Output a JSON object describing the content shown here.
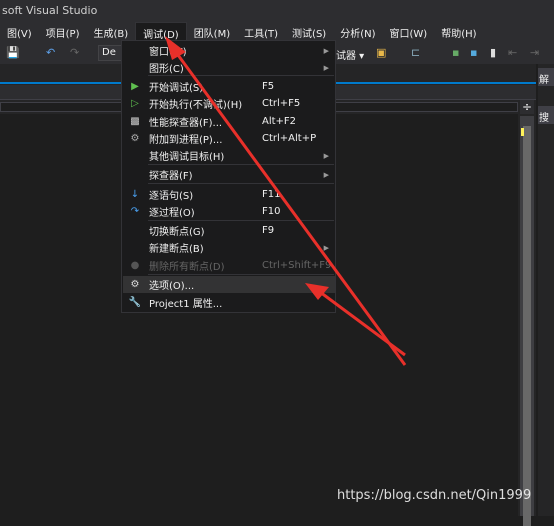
{
  "window": {
    "title": "soft Visual Studio"
  },
  "menubar": [
    "图(V)",
    "项目(P)",
    "生成(B)",
    "调试(D)",
    "团队(M)",
    "工具(T)",
    "测试(S)",
    "分析(N)",
    "窗口(W)",
    "帮助(H)"
  ],
  "toolbar": {
    "config": "De",
    "debugger_tail": "试器 ▾"
  },
  "right_panel": {
    "header": "解",
    "search": "搜"
  },
  "debug_menu": [
    {
      "label": "窗口(W)",
      "shortcut": "",
      "submenu": true,
      "icon": ""
    },
    {
      "label": "图形(C)",
      "shortcut": "",
      "submenu": true,
      "icon": ""
    },
    {
      "label": "开始调试(S)",
      "shortcut": "F5",
      "icon": "play-icon"
    },
    {
      "label": "开始执行(不调试)(H)",
      "shortcut": "Ctrl+F5",
      "icon": "play-outline-icon"
    },
    {
      "label": "性能探查器(F)...",
      "shortcut": "Alt+F2",
      "icon": "performance-icon"
    },
    {
      "label": "附加到进程(P)...",
      "shortcut": "Ctrl+Alt+P",
      "icon": "attach-icon"
    },
    {
      "label": "其他调试目标(H)",
      "shortcut": "",
      "submenu": true,
      "icon": ""
    },
    {
      "label": "探查器(F)",
      "shortcut": "",
      "submenu": true,
      "icon": ""
    },
    {
      "label": "逐语句(S)",
      "shortcut": "F11",
      "icon": "step-into-icon"
    },
    {
      "label": "逐过程(O)",
      "shortcut": "F10",
      "icon": "step-over-icon"
    },
    {
      "label": "切换断点(G)",
      "shortcut": "F9",
      "icon": ""
    },
    {
      "label": "新建断点(B)",
      "shortcut": "",
      "submenu": true,
      "icon": ""
    },
    {
      "label": "删除所有断点(D)",
      "shortcut": "Ctrl+Shift+F9",
      "disabled": true,
      "icon": "delete-breakpoints-icon"
    },
    {
      "label": "选项(O)...",
      "shortcut": "",
      "highlighted": true,
      "icon": "gear-icon"
    },
    {
      "label": "Project1 属性...",
      "shortcut": "",
      "icon": "wrench-icon"
    }
  ],
  "watermark": "https://blog.csdn.net/Qin1999",
  "colors": {
    "accent": "#007acc",
    "annotation": "#e8302a"
  }
}
